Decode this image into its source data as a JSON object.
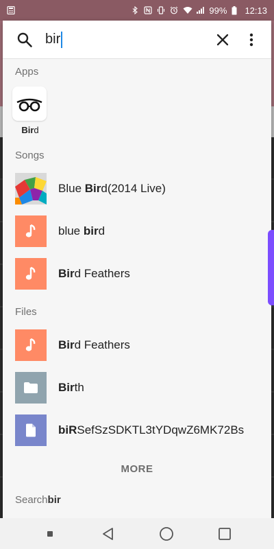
{
  "status_bar": {
    "battery": "99%",
    "time": "12:13",
    "icons": [
      "calculator-icon",
      "bluetooth-icon",
      "nfc-icon",
      "vibrate-icon",
      "alarm-icon",
      "wifi-icon",
      "signal-icon",
      "battery-icon"
    ]
  },
  "search": {
    "query": "bir",
    "icons": {
      "search": "search-icon",
      "clear": "close-icon",
      "menu": "more-vert-icon"
    }
  },
  "apps": {
    "label": "Apps",
    "items": [
      {
        "name_bold": "Bir",
        "name_rest": "d",
        "icon": "bird-app-icon"
      }
    ]
  },
  "songs": {
    "label": "Songs",
    "items": [
      {
        "pre": "Blue ",
        "bold": "Bir",
        "post": "d(2014 Live)",
        "thumb": "album-art"
      },
      {
        "pre": "blue ",
        "bold": "bir",
        "post": "d",
        "thumb": "music-note-icon"
      },
      {
        "pre": "",
        "bold": "Bir",
        "post": "d Feathers",
        "thumb": "music-note-icon"
      }
    ]
  },
  "files": {
    "label": "Files",
    "items": [
      {
        "pre": "",
        "bold": "Bir",
        "post": "d Feathers",
        "thumb": "music-note-icon"
      },
      {
        "pre": "",
        "bold": "Bir",
        "post": "th",
        "thumb": "folder-icon"
      },
      {
        "pre": "",
        "bold": "biR",
        "post": "SefSzSDKTL3tYDqwZ6MK72Bs",
        "thumb": "document-icon"
      }
    ]
  },
  "more_label": "MORE",
  "search_web": {
    "prefix": "Search ",
    "query": "bir"
  },
  "colors": {
    "music_tile": "#ff8a65",
    "folder_tile": "#90a4ae",
    "doc_tile": "#7986cb",
    "edge_handle": "#7c4dff",
    "caret": "#1e88e5"
  }
}
